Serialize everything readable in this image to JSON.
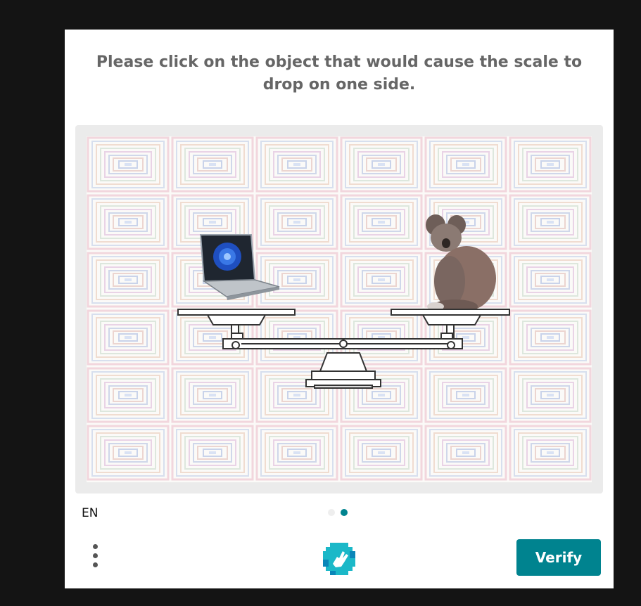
{
  "prompt": {
    "text": "Please click on the object that would cause the scale to drop on one side."
  },
  "challenge": {
    "left_object": "laptop",
    "right_object": "koala",
    "background_pattern": "concentric-squares"
  },
  "footer": {
    "language": "EN",
    "pages": {
      "total": 2,
      "current": 2
    },
    "verify_label": "Verify"
  },
  "colors": {
    "accent": "#00838f",
    "text_muted": "#666666",
    "backdrop": "#141414"
  },
  "icons": {
    "menu": "more-vertical-icon",
    "logo": "hcaptcha-hand-icon"
  }
}
